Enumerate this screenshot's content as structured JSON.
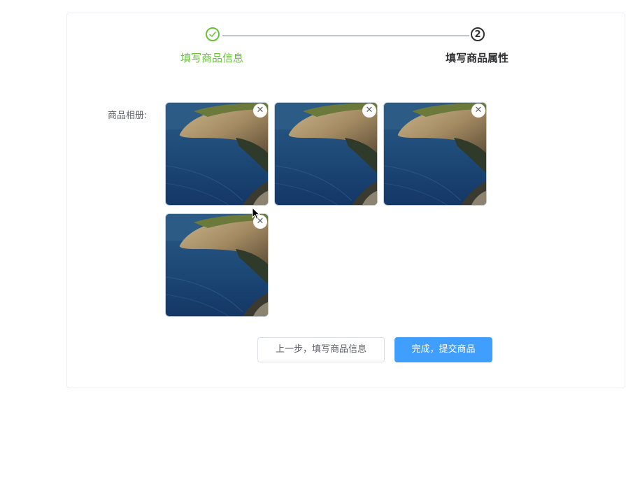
{
  "steps": [
    {
      "title": "填写商品信息",
      "status": "finished",
      "icon": "check-icon",
      "color": "#67c23a"
    },
    {
      "title": "填写商品属性",
      "status": "active",
      "number": "2",
      "color": "#303133"
    }
  ],
  "form": {
    "album_label": "商品相册:",
    "images": [
      {
        "icon": "image-thumbnail",
        "remove_glyph": "✕"
      },
      {
        "icon": "image-thumbnail",
        "remove_glyph": "✕"
      },
      {
        "icon": "image-thumbnail",
        "remove_glyph": "✕"
      },
      {
        "icon": "image-thumbnail",
        "remove_glyph": "✕"
      }
    ]
  },
  "buttons": {
    "prev_label": "上一步，填写商品信息",
    "finish_label": "完成，提交商品"
  },
  "colors": {
    "success": "#67c23a",
    "primary": "#409eff",
    "text": "#303133"
  }
}
